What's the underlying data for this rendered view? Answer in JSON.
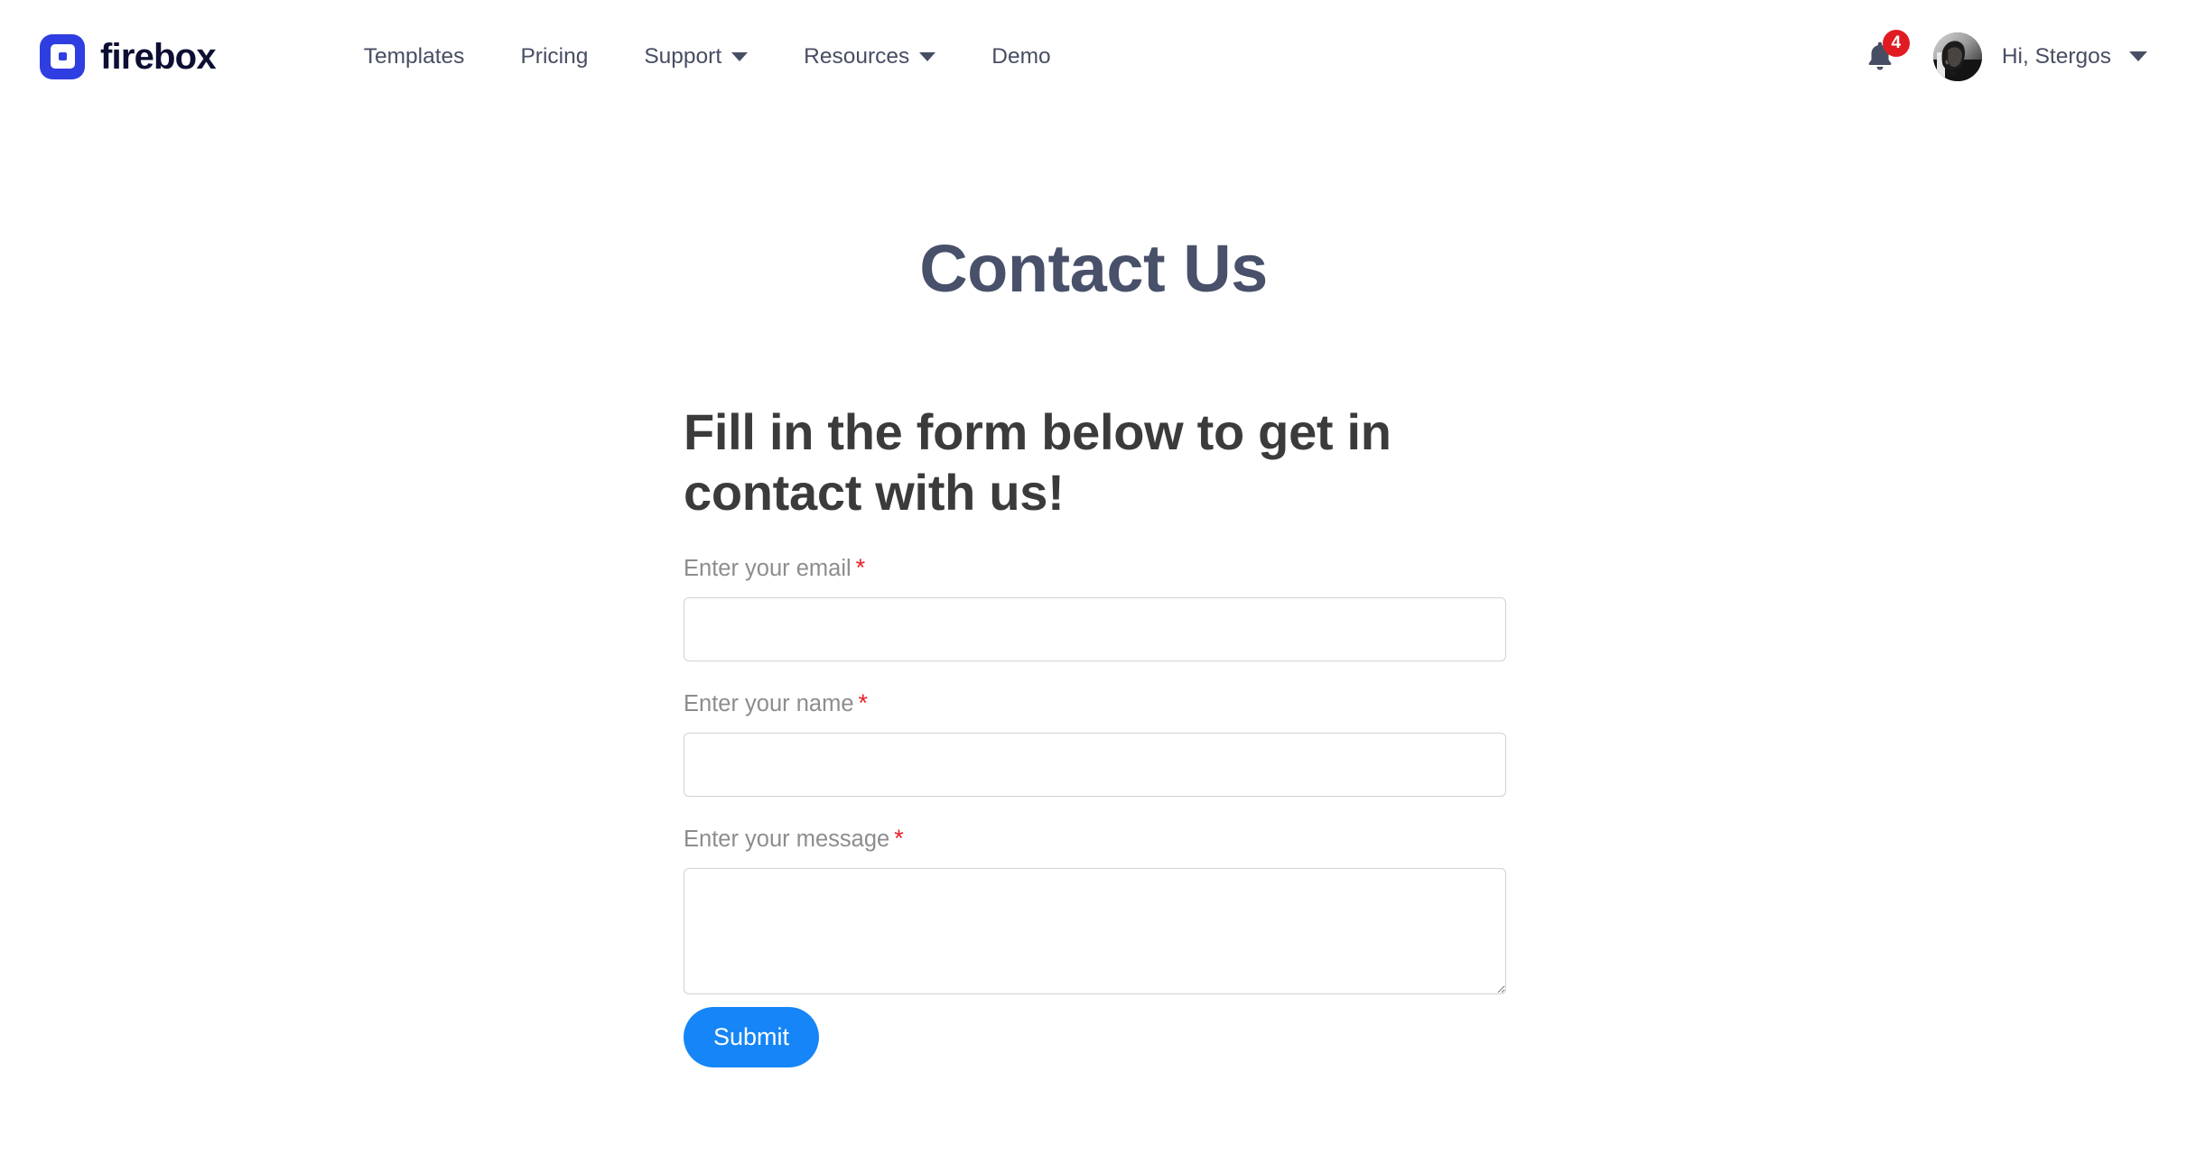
{
  "header": {
    "brand": {
      "name": "firebox",
      "mark_color": "#2f3ee0",
      "text_color": "#0c0e33"
    },
    "nav": [
      {
        "label": "Templates",
        "has_dropdown": false
      },
      {
        "label": "Pricing",
        "has_dropdown": false
      },
      {
        "label": "Support",
        "has_dropdown": true
      },
      {
        "label": "Resources",
        "has_dropdown": true
      },
      {
        "label": "Demo",
        "has_dropdown": false
      }
    ],
    "notifications": {
      "icon": "bell-icon",
      "count": "4",
      "badge_color": "#e01b22"
    },
    "user": {
      "greeting": "Hi, Stergos",
      "avatar_alt": "user-avatar",
      "has_dropdown": true
    }
  },
  "main": {
    "page_title": "Contact Us",
    "form": {
      "heading": "Fill in the form below to get in contact with us!",
      "required_marker": "*",
      "fields": [
        {
          "label": "Enter your email",
          "required": true,
          "value": "",
          "placeholder": "",
          "type": "input"
        },
        {
          "label": "Enter your name",
          "required": true,
          "value": "",
          "placeholder": "",
          "type": "input"
        },
        {
          "label": "Enter your message",
          "required": true,
          "value": "",
          "placeholder": "",
          "type": "textarea"
        }
      ],
      "submit_label": "Submit",
      "submit_color": "#1585f7"
    }
  }
}
